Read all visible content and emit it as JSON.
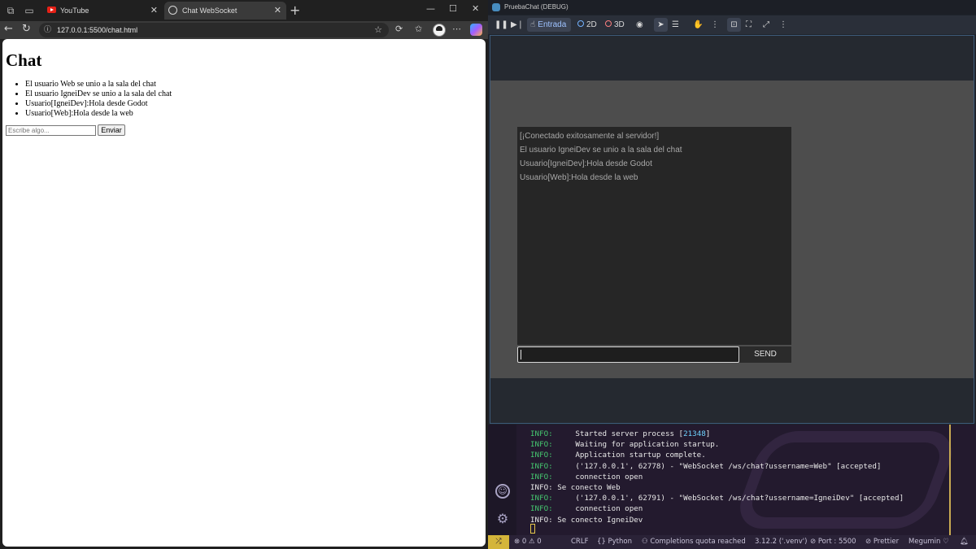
{
  "browser": {
    "tabs": [
      {
        "label": "YouTube"
      },
      {
        "label": "Chat WebSocket"
      }
    ],
    "address": "127.0.0.1:5500/chat.html",
    "page": {
      "heading": "Chat",
      "messages": [
        "El usuario Web se unio a la sala del chat",
        "El usuario IgneiDev se unio a la sala del chat",
        "Usuario[IgneiDev]:Hola desde Godot",
        "Usuario[Web]:Hola desde la web"
      ],
      "input_placeholder": "Escribe algo...",
      "send_label": "Enviar"
    }
  },
  "godot": {
    "window_title": "PruebaChat (DEBUG)",
    "toolbar": {
      "input_label": "Entrada",
      "mode_2d": "2D",
      "mode_3d": "3D"
    },
    "chat_lines": [
      "[¡Conectado exitosamente al servidor!]",
      "El usuario IgneiDev se unio a la sala del chat",
      "Usuario[IgneiDev]:Hola desde Godot",
      "Usuario[Web]:Hola desde la web"
    ],
    "send_label": "SEND"
  },
  "terminal": {
    "lines": [
      {
        "level": "INFO:",
        "text": "     Started server process [",
        "num": "21348",
        "tail": "]"
      },
      {
        "level": "INFO:",
        "text": "     Waiting for application startup."
      },
      {
        "level": "INFO:",
        "text": "     Application startup complete."
      },
      {
        "level": "INFO:",
        "text": "     ('127.0.0.1', 62778) - \"WebSocket /ws/chat?ussername=Web\" [accepted]"
      },
      {
        "level": "INFO:",
        "text": "     connection open"
      },
      {
        "level": "",
        "text": "INFO: Se conecto Web"
      },
      {
        "level": "INFO:",
        "text": "     ('127.0.0.1', 62791) - \"WebSocket /ws/chat?ussername=IgneiDev\" [accepted]"
      },
      {
        "level": "INFO:",
        "text": "     connection open"
      },
      {
        "level": "",
        "text": "INFO: Se conecto IgneiDev"
      }
    ]
  },
  "statusbar": {
    "errors": "0",
    "warnings": "0",
    "eol": "CRLF",
    "language": "Python",
    "completions": "Completions quota reached",
    "interpreter": "3.12.2 ('.venv')",
    "port": "Port : 5500",
    "prettier": "Prettier",
    "theme": "Megumin"
  },
  "colors": {
    "godot_accent": "#478cbf",
    "terminal_level": "#45c76f",
    "status_remote": "#d4b53a"
  }
}
